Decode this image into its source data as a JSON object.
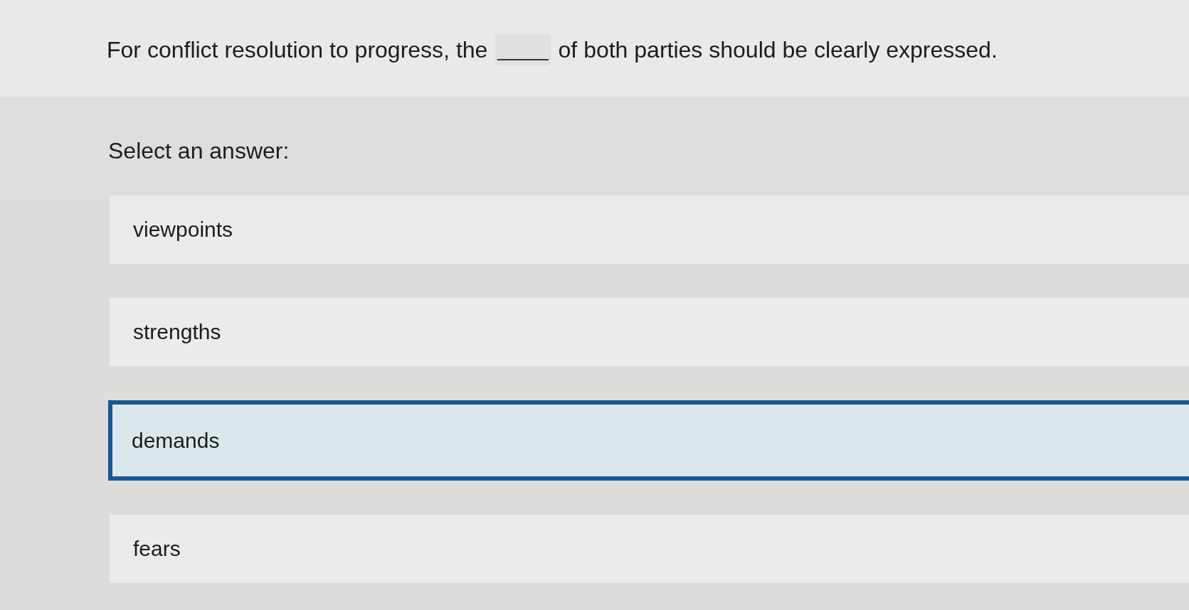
{
  "question": {
    "text_before": "For conflict resolution to progress, the",
    "blank": "____",
    "text_after": "of both parties should be clearly expressed."
  },
  "prompt": "Select an answer:",
  "options": [
    {
      "label": "viewpoints",
      "selected": false
    },
    {
      "label": "strengths",
      "selected": false
    },
    {
      "label": "demands",
      "selected": true
    },
    {
      "label": "fears",
      "selected": false
    }
  ]
}
